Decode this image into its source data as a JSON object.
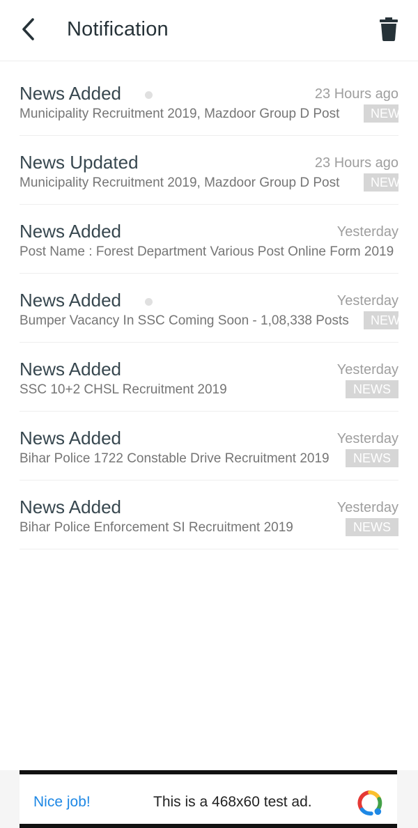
{
  "header": {
    "title": "Notification",
    "back_icon": "chevron-left-icon",
    "delete_icon": "trash-icon"
  },
  "notifications": [
    {
      "title": "News Added",
      "time": "23 Hours ago",
      "description": "Municipality Recruitment 2019, Mazdoor Group D Post",
      "badge": "NEWS",
      "unread": true
    },
    {
      "title": "News Updated",
      "time": "23 Hours ago",
      "description": "Municipality Recruitment 2019, Mazdoor Group D Post",
      "badge": "NEWS",
      "unread": false
    },
    {
      "title": "News Added",
      "time": "Yesterday",
      "description": "Post Name : Forest Department Various Post Online Form 2019",
      "badge": "",
      "unread": false
    },
    {
      "title": "News Added",
      "time": "Yesterday",
      "description": "Bumper Vacancy In SSC Coming Soon - 1,08,338 Posts",
      "badge": "NEWS",
      "unread": true
    },
    {
      "title": "News Added",
      "time": "Yesterday",
      "description": "SSC 10+2 CHSL Recruitment 2019",
      "badge": "NEWS",
      "unread": false
    },
    {
      "title": "News Added",
      "time": "Yesterday",
      "description": "Bihar Police 1722 Constable Drive Recruitment 2019",
      "badge": "NEWS",
      "unread": false
    },
    {
      "title": "News Added",
      "time": "Yesterday",
      "description": "Bihar Police Enforcement SI Recruitment 2019",
      "badge": "NEWS",
      "unread": false
    }
  ],
  "ad": {
    "label": "Nice job!",
    "text": "This is a 468x60 test ad."
  },
  "colors": {
    "badge_bg": "#d6d6d6",
    "ad_link": "#1e88e5",
    "unread_dot": "#e0e0e0"
  }
}
